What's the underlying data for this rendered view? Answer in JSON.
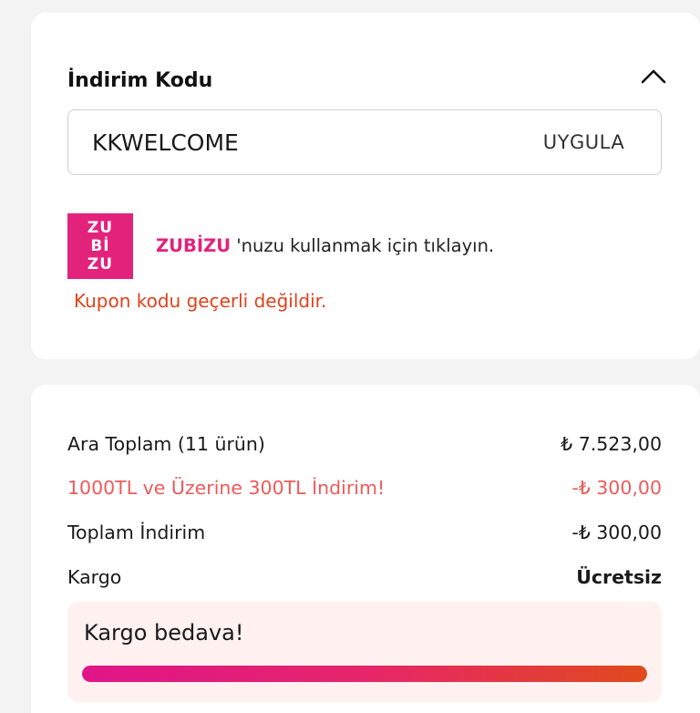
{
  "coupon": {
    "title": "İndirim Kodu",
    "code_value": "KKWELCOME",
    "apply_label": "UYGULA",
    "zubizu_logo_lines": [
      "ZU",
      "Bİ",
      "ZU"
    ],
    "zubizu_brand": "ZUBİZU",
    "zubizu_text": " 'nuzu kullanmak için tıklayın.",
    "error": "Kupon kodu geçerli değildir.",
    "collapse_icon": "chevron-up-icon"
  },
  "summary": {
    "subtotal_label": "Ara Toplam (11 ürün)",
    "subtotal_value": "₺ 7.523,00",
    "promo_label": "1000TL ve Üzerine 300TL İndirim!",
    "promo_value": "-₺ 300,00",
    "total_discount_label": "Toplam İndirim",
    "total_discount_value": "-₺ 300,00",
    "shipping_label": "Kargo",
    "shipping_value": "Ücretsiz",
    "free_shipping_text": "Kargo bedava!",
    "free_shipping_progress": 1.0
  },
  "colors": {
    "brand_pink": "#e3227c",
    "error_red": "#e0421c",
    "promo_red": "#ee5a5a"
  }
}
